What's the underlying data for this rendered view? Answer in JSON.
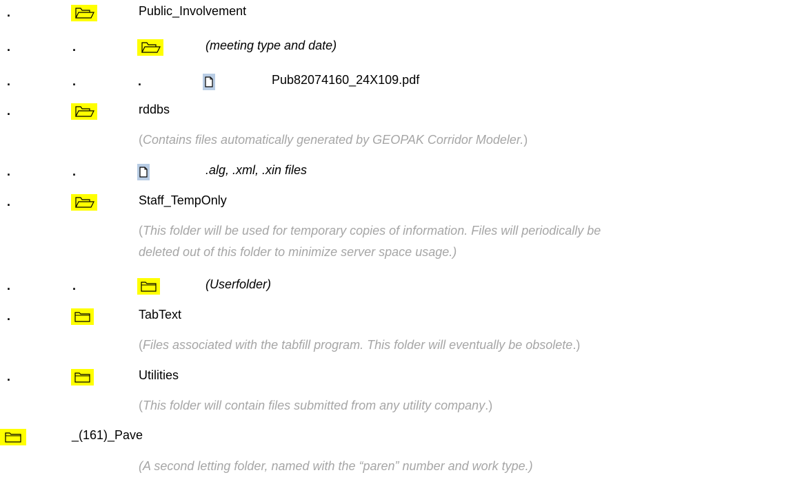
{
  "dot": ".",
  "colors": {
    "highlight": "#ffff00",
    "file_bg": "#b8cce4",
    "note_text": "#a6a6a6"
  },
  "entries": [
    {
      "name": "Public_Involvement",
      "icon": "open-folder-icon"
    },
    {
      "name": "(meeting type and date)",
      "icon": "open-folder-icon"
    },
    {
      "name": "Pub82074160_24X109.pdf",
      "icon": "file-icon"
    },
    {
      "name": "rddbs",
      "icon": "open-folder-icon",
      "note": {
        "open": "(",
        "text": "Contains files automatically generated by GEOPAK Corridor Modeler.",
        "close": ")"
      }
    },
    {
      "name": ".alg, .xml, .xin files",
      "icon": "file-icon"
    },
    {
      "name": "Staff_TempOnly",
      "icon": "open-folder-icon",
      "note": {
        "open": "(",
        "line1": "This folder will be used for temporary copies of information.  Files will periodically be",
        "line2": "deleted out of this folder to minimize server space usage.)"
      }
    },
    {
      "name": "(Userfolder)",
      "icon": "closed-folder-icon"
    },
    {
      "name": "TabText",
      "icon": "closed-folder-icon",
      "note": {
        "open": "(",
        "text": "Files associated with the tabfill program.  This folder will eventually be obsolete",
        "close": ".)"
      }
    },
    {
      "name": "Utilities",
      "icon": "closed-folder-icon",
      "note": {
        "open": "(",
        "text": "This folder will contain files submitted from any utility company",
        "close": ".)"
      }
    },
    {
      "name": "_(161)_Pave",
      "icon": "closed-folder-icon",
      "note": {
        "text": "(A second letting folder, named with the “paren” number and work type.)"
      }
    }
  ]
}
